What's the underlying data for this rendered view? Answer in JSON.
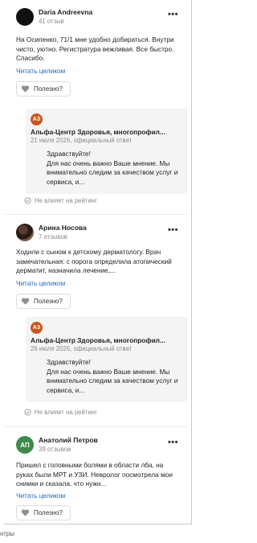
{
  "reviews": [
    {
      "name": "Daria Andreevna",
      "meta": "41 отзыв",
      "text": "На Осипенко, 71/1 мне удобно добираться. Внутри чисто, уютно. Регистратура вежливая. Все быстро. Спасибо.",
      "read_more": "Читать целиком",
      "helpful": "Полезно?",
      "reply": {
        "badge": "АЗ",
        "org": "Альфа-Центр Здоровья, многопрофил...",
        "sub": "21 июля 2026, официальный ответ",
        "text": "Здравствуйте!\nДля нас очень важно Ваше мнение. Мы внимательно следим за качеством услуг и сервиса, и..."
      },
      "rating_note": "Не влияет на рейтинг"
    },
    {
      "name": "Арина Носова",
      "meta": "7 отзывов",
      "text": "Ходили с сыном к детскому дерматологу. Врач замечательная: с порога определила атопический дерматит, назначила лечение,...",
      "read_more": "Читать целиком",
      "helpful": "Полезно?",
      "reply": {
        "badge": "АЗ",
        "org": "Альфа-Центр Здоровья, многопрофил...",
        "sub": "26 июля 2026, официальный ответ",
        "text": "Здравствуйте!\nДля нас очень важно Ваше мнение. Мы внимательно следим за качеством услуг и сервиса, и..."
      },
      "rating_note": "Не влияет на рейтинг"
    },
    {
      "name": "Анатолий Петров",
      "meta": "39 отзывов",
      "avatar_initials": "АП",
      "text": "Пришел с головными болями в области лба, на руках были МРТ и УЗИ. Невролог посмотрела мои снимки и сказала, что нужн...",
      "read_more": "Читать целиком",
      "helpful": "Полезно?"
    }
  ],
  "more_glyph": "•••",
  "footer_fragment": "нтры",
  "colors": {
    "link": "#2068c7",
    "badge": "#c8571f",
    "avatar_green": "#3e8a4b"
  }
}
